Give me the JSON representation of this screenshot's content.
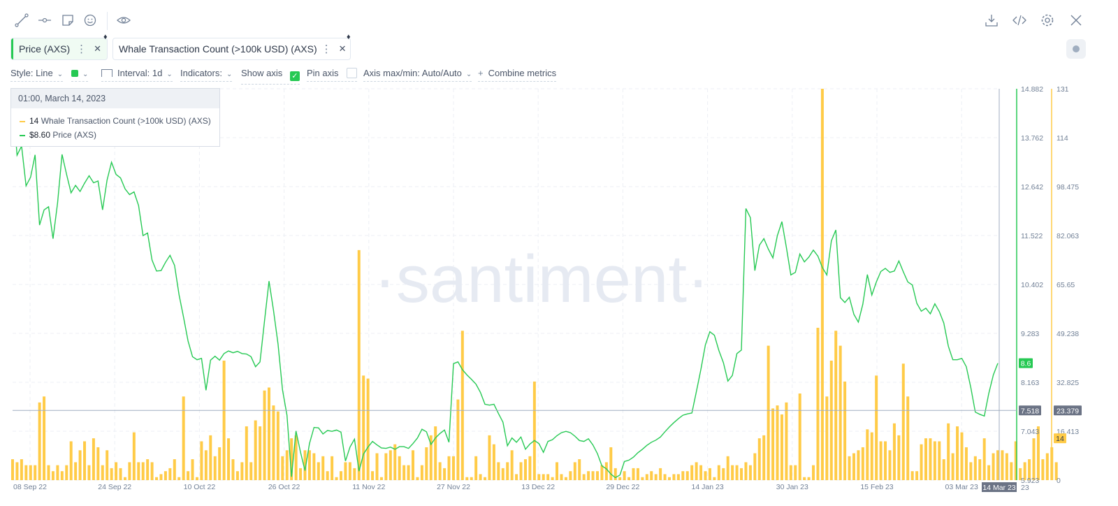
{
  "toolbar": {
    "left_icons": [
      "line-draw-icon",
      "horizontal-ray-icon",
      "sticky-note-icon",
      "emoji-icon",
      "eye-icon"
    ],
    "right_icons": [
      "download-icon",
      "embed-code-icon",
      "settings-icon",
      "close-icon"
    ]
  },
  "metrics": [
    {
      "label": "Price (AXS)",
      "color": "#26c953"
    },
    {
      "label": "Whale Transaction Count (>100k USD) (AXS)",
      "color": "#ffcb47"
    }
  ],
  "controls": {
    "style": "Style: Line",
    "interval": "Interval: 1d",
    "indicators": "Indicators:",
    "show_axis": "Show axis",
    "pin_axis": "Pin axis",
    "axis_maxmin": "Axis max/min: Auto/Auto",
    "combine": "Combine metrics"
  },
  "tooltip": {
    "date": "01:00, March 14, 2023",
    "whale_value": "14",
    "whale_label": "Whale Transaction Count (>100k USD) (AXS)",
    "price_value": "$8.60",
    "price_label": "Price (AXS)"
  },
  "watermark": "·santiment·",
  "chart_data": {
    "type": "line",
    "x_tick_labels": [
      "08 Sep 22",
      "24 Sep 22",
      "10 Oct 22",
      "26 Oct 22",
      "11 Nov 22",
      "27 Nov 22",
      "13 Dec 22",
      "29 Dec 22",
      "14 Jan 23",
      "30 Jan 23",
      "15 Feb 23",
      "03 Mar 23"
    ],
    "x_range": [
      "2022-09-07",
      "2023-03-14"
    ],
    "price_axis": {
      "ticks": [
        "14.882",
        "13.762",
        "12.642",
        "11.522",
        "10.402",
        "9.283",
        "8.163",
        "7.043",
        "5.923"
      ],
      "range": [
        5.923,
        14.882
      ]
    },
    "whale_axis": {
      "ticks": [
        "131",
        "114",
        "98.475",
        "82.063",
        "65.65",
        "49.238",
        "32.825",
        "16.413",
        "0"
      ],
      "range": [
        0,
        131
      ]
    },
    "crosshair": {
      "price": "7.518",
      "whale": "23.379",
      "date": "14 Mar 23",
      "date_suffix": "23"
    },
    "current": {
      "price": "8.6",
      "whale": "14"
    },
    "series": [
      {
        "name": "Price (AXS)",
        "kind": "line",
        "color": "#26c953",
        "values": [
          14.75,
          13.36,
          13.57,
          12.66,
          12.86,
          13.37,
          11.76,
          12.11,
          12.18,
          11.45,
          12.27,
          13.38,
          12.92,
          12.5,
          12.67,
          12.53,
          12.72,
          12.89,
          12.73,
          12.77,
          12.11,
          12.79,
          13.2,
          12.92,
          12.84,
          12.59,
          12.46,
          12.52,
          12.21,
          11.52,
          11.58,
          10.96,
          10.71,
          10.72,
          10.91,
          11.07,
          10.84,
          10.17,
          9.65,
          9.11,
          8.75,
          8.68,
          8.71,
          7.98,
          8.67,
          8.76,
          8.67,
          8.82,
          8.88,
          8.84,
          8.87,
          8.82,
          8.81,
          8.75,
          8.52,
          8.63,
          9.56,
          10.48,
          9.81,
          9.04,
          7.99,
          7.41,
          6.0,
          7.05,
          6.56,
          6.14,
          6.76,
          7.13,
          7.12,
          6.98,
          7.06,
          7.04,
          7.07,
          7.02,
          6.36,
          6.68,
          6.86,
          6.13,
          6.52,
          6.68,
          6.81,
          6.73,
          6.66,
          6.65,
          6.68,
          6.63,
          6.69,
          6.69,
          6.65,
          6.76,
          6.89,
          7.09,
          7.03,
          6.74,
          6.89,
          6.99,
          7.07,
          6.79,
          8.59,
          8.63,
          8.45,
          8.33,
          8.23,
          8.12,
          7.93,
          7.66,
          7.64,
          7.66,
          7.45,
          7.25,
          6.71,
          6.89,
          6.79,
          6.91,
          6.63,
          6.75,
          6.83,
          6.76,
          6.56,
          6.81,
          6.85,
          6.94,
          7.01,
          7.04,
          7.01,
          6.93,
          6.83,
          6.81,
          6.87,
          6.73,
          6.53,
          6.25,
          6.18,
          6.06,
          5.98,
          6.04,
          6.35,
          6.38,
          6.45,
          6.55,
          6.63,
          6.72,
          6.79,
          6.84,
          6.91,
          7.03,
          7.14,
          7.24,
          7.33,
          7.41,
          7.44,
          7.46,
          7.95,
          8.46,
          9.02,
          9.32,
          9.24,
          8.89,
          8.61,
          8.19,
          8.32,
          8.82,
          8.9,
          12.14,
          11.93,
          10.72,
          11.3,
          11.45,
          11.21,
          11.01,
          11.52,
          11.84,
          11.25,
          10.62,
          10.68,
          11.1,
          10.92,
          11.03,
          11.19,
          11.05,
          10.79,
          10.62,
          11.4,
          11.65,
          10.1,
          9.99,
          10.11,
          9.72,
          9.54,
          9.95,
          10.63,
          10.16,
          10.46,
          10.7,
          10.77,
          10.68,
          10.71,
          10.94,
          10.69,
          10.46,
          10.39,
          9.97,
          9.79,
          9.86,
          9.73,
          9.96,
          9.78,
          9.52,
          8.99,
          8.68,
          8.68,
          8.71,
          8.52,
          8.04,
          7.48,
          7.43,
          7.39,
          7.91,
          8.33,
          8.6
        ]
      },
      {
        "name": "Whale Transaction Count (>100k USD) (AXS)",
        "kind": "bar",
        "color": "#ffcb47",
        "values": [
          7,
          6,
          7,
          5,
          5,
          5,
          26,
          28,
          5,
          3,
          5,
          3,
          5,
          13,
          6,
          10,
          13,
          5,
          14,
          11,
          5,
          10,
          4,
          6,
          4,
          1,
          6,
          16,
          6,
          6,
          7,
          6,
          1,
          2,
          3,
          4,
          7,
          1,
          28,
          3,
          7,
          1,
          13,
          10,
          15,
          8,
          11,
          40,
          14,
          7,
          3,
          6,
          18,
          6,
          20,
          18,
          30,
          31,
          25,
          23,
          8,
          10,
          14,
          15,
          4,
          10,
          10,
          9,
          6,
          8,
          3,
          8,
          1,
          3,
          6,
          6,
          4,
          77,
          35,
          34,
          3,
          9,
          1,
          9,
          10,
          12,
          8,
          5,
          5,
          10,
          1,
          5,
          11,
          15,
          18,
          6,
          4,
          8,
          8,
          27,
          50,
          1,
          1,
          8,
          2,
          1,
          15,
          12,
          6,
          4,
          6,
          10,
          2,
          6,
          7,
          8,
          33,
          2,
          2,
          2,
          1,
          6,
          2,
          1,
          3,
          6,
          7,
          2,
          3,
          3,
          3,
          5,
          6,
          11,
          4,
          1,
          3,
          1,
          4,
          4,
          1,
          2,
          3,
          2,
          4,
          2,
          1,
          2,
          2,
          3,
          3,
          5,
          6,
          5,
          3,
          4,
          1,
          5,
          4,
          8,
          5,
          5,
          4,
          6,
          5,
          9,
          14,
          15,
          45,
          24,
          25,
          22,
          26,
          5,
          5,
          29,
          1,
          1,
          5,
          51,
          131,
          28,
          40,
          50,
          45,
          33,
          8,
          9,
          10,
          11,
          17,
          16,
          35,
          13,
          13,
          10,
          19,
          15,
          39,
          28,
          3,
          3,
          12,
          14,
          14,
          13,
          13,
          7,
          19,
          9,
          18,
          16,
          11,
          6,
          8,
          7,
          14,
          5,
          9,
          10,
          10,
          9,
          6,
          13,
          4,
          6,
          7,
          14,
          18,
          7,
          9,
          11,
          6
        ]
      }
    ]
  }
}
